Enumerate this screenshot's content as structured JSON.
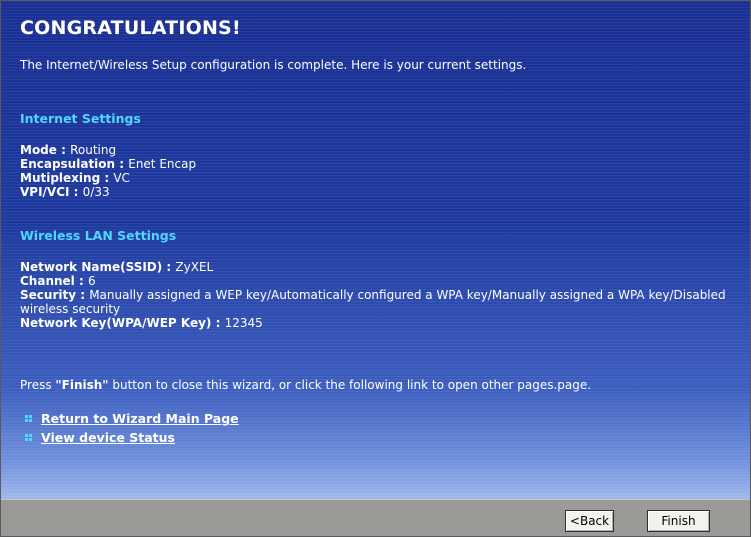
{
  "title": "CONGRATULATIONS!",
  "intro": "The Internet/Wireless Setup configuration is complete. Here is your current settings.",
  "internet": {
    "heading": "Internet Settings",
    "mode_label": "Mode : ",
    "mode_value": "Routing",
    "encap_label": "Encapsulation : ",
    "encap_value": "Enet Encap",
    "mux_label": "Mutiplexing : ",
    "mux_value": "VC",
    "vpi_label": "VPI/VCI : ",
    "vpi_value": "0/33"
  },
  "wireless": {
    "heading": "Wireless LAN Settings",
    "ssid_label": "Network Name(SSID) : ",
    "ssid_value": "ZyXEL",
    "channel_label": "Channel : ",
    "channel_value": "6",
    "security_label": "Security : ",
    "security_value": "Manually assigned a WEP key/Automatically configured a WPA key/Manually assigned a WPA key/Disabled wireless security",
    "key_label": "Network Key(WPA/WEP Key) : ",
    "key_value": "12345"
  },
  "finish_note": {
    "prefix": "Press ",
    "button_word": "\"Finish\"",
    "suffix": " button to close this wizard, or click the following link to open other pages.page."
  },
  "links": {
    "wizard_main": "Return to Wizard Main Page",
    "device_status": "View device Status"
  },
  "buttons": {
    "back": "<Back",
    "finish": "Finish"
  },
  "colors": {
    "background": "#1f3a9c",
    "section_heading": "#4fd7ff",
    "footer": "#9c9a97"
  }
}
